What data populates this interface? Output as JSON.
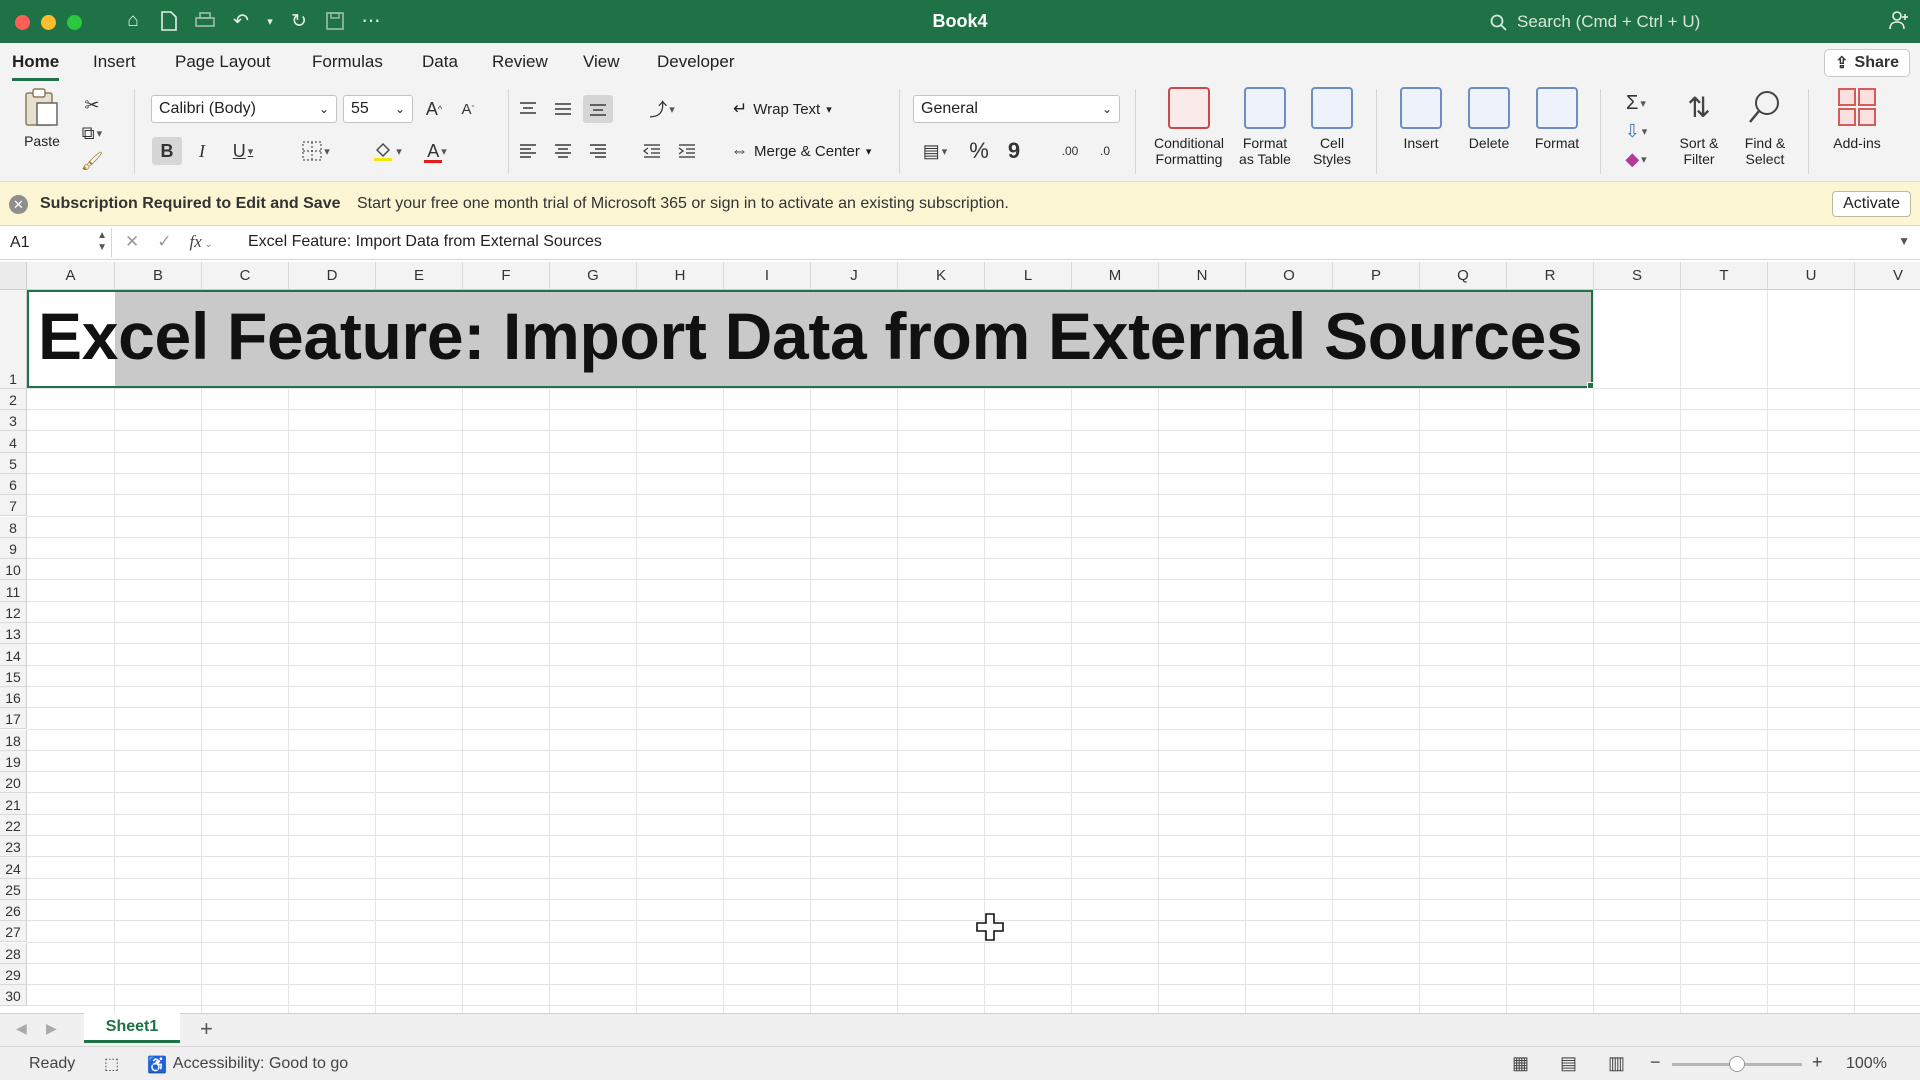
{
  "window": {
    "title": "Book4"
  },
  "colors": {
    "accent": "#1f7245",
    "close": "#fe5f57",
    "minimize": "#febc2e",
    "maximize": "#28c840"
  },
  "search": {
    "placeholder": "Search (Cmd + Ctrl + U)"
  },
  "tabs": [
    "Home",
    "Insert",
    "Page Layout",
    "Formulas",
    "Data",
    "Review",
    "View",
    "Developer"
  ],
  "share_label": "Share",
  "ribbon": {
    "paste": "Paste",
    "font_name": "Calibri (Body)",
    "font_size": "55",
    "bold": "B",
    "italic": "I",
    "underline": "U",
    "grow": "A",
    "shrink": "A",
    "fontcolor": "A",
    "wrap": "Wrap Text",
    "merge": "Merge & Center",
    "numfmt": "General",
    "percent": "%",
    "comma": "9",
    "inc_dec": ".00",
    "dec_dec": ".0",
    "cond1": "Conditional",
    "cond2": "Formatting",
    "fat1": "Format",
    "fat2": "as Table",
    "cs1": "Cell",
    "cs2": "Styles",
    "insert": "Insert",
    "delete": "Delete",
    "format": "Format",
    "sort1": "Sort &",
    "sort2": "Filter",
    "find1": "Find &",
    "find2": "Select",
    "addins": "Add-ins"
  },
  "banner": {
    "title": "Subscription Required to Edit and Save",
    "message": "Start your free one month trial of Microsoft 365 or sign in to activate an existing subscription.",
    "button": "Activate"
  },
  "formula_bar": {
    "namebox": "A1",
    "fx": "fx",
    "value": "Excel Feature: Import Data from External Sources"
  },
  "columns": [
    "A",
    "B",
    "C",
    "D",
    "E",
    "F",
    "G",
    "H",
    "I",
    "J",
    "K",
    "L",
    "M",
    "N",
    "O",
    "P",
    "Q",
    "R",
    "S",
    "T",
    "U",
    "V"
  ],
  "rows": [
    "1",
    "2",
    "3",
    "4",
    "5",
    "6",
    "7",
    "8",
    "9",
    "10",
    "11",
    "12",
    "13",
    "14",
    "15",
    "16",
    "17",
    "18",
    "19",
    "20",
    "21",
    "22",
    "23",
    "24",
    "25",
    "26",
    "27",
    "28",
    "29",
    "30"
  ],
  "cell_a1": "Excel Feature: Import Data from External Sources",
  "sheet": {
    "name": "Sheet1",
    "add": "+"
  },
  "status": {
    "ready": "Ready",
    "accessibility": "Accessibility: Good to go",
    "zoom": "100%",
    "zoom_level": 0.5
  }
}
